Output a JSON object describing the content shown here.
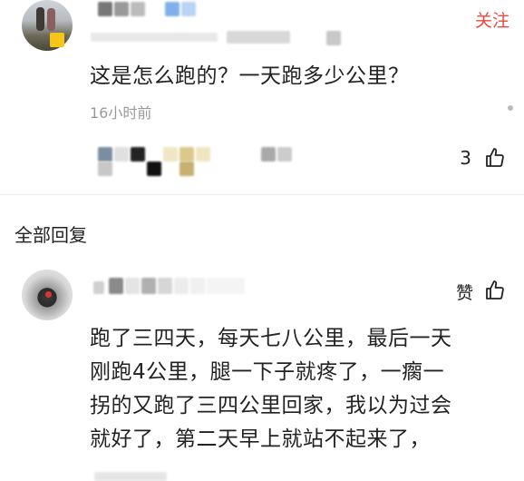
{
  "comment": {
    "follow_label": "关注",
    "text": "这是怎么跑的？一天跑多少公里？",
    "time": "16小时前",
    "likes": "3"
  },
  "replies_section": {
    "title": "全部回复"
  },
  "reply": {
    "like_label": "赞",
    "lines": [
      "跑了三四天，每天七八公里，最后一天",
      "刚跑4公里，腿一下子就疼了，一瘸一",
      "拐的又跑了三四公里回家，我以为过会",
      "就好了，第二天早上就站不起来了，"
    ]
  },
  "colors": {
    "accent": "#e84a3b",
    "text": "#222222",
    "muted": "#999999"
  },
  "icons": {
    "like": "thumbs-up-icon",
    "more": "more-icon"
  }
}
